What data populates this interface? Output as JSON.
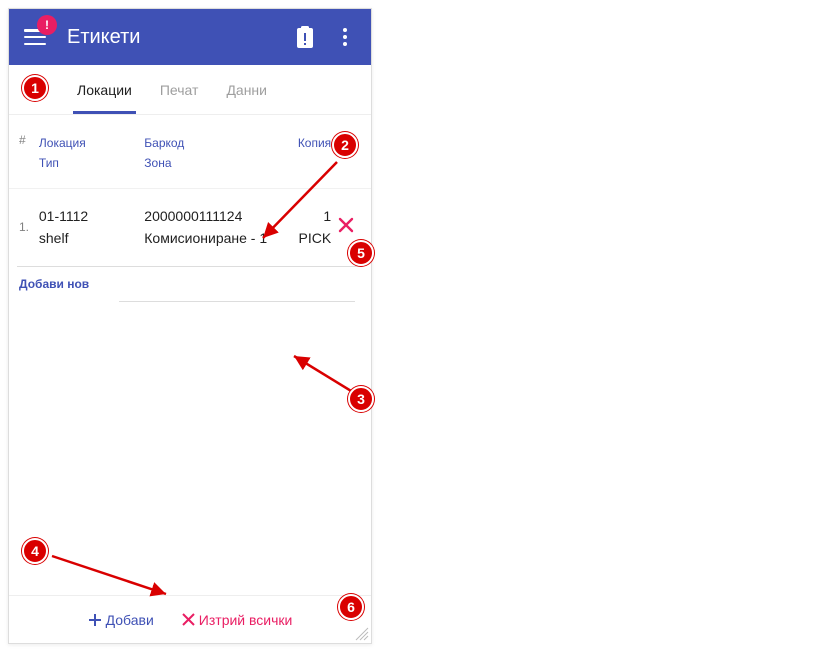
{
  "header": {
    "title": "Етикети",
    "alert_badge": "!"
  },
  "tabs": [
    {
      "label": "Локации",
      "active": true
    },
    {
      "label": "Печат",
      "active": false
    },
    {
      "label": "Данни",
      "active": false
    }
  ],
  "table": {
    "headers": {
      "index": "#",
      "col1a": "Локация",
      "col1b": "Тип",
      "col2a": "Баркод",
      "col2b": "Зона",
      "col3": "Копия"
    },
    "rows": [
      {
        "index": "1.",
        "location": "01-1112",
        "type": "shelf",
        "barcode": "2000000111124",
        "zone": "Комисиониране - 1",
        "copies": "1",
        "copies2": "PICK"
      }
    ]
  },
  "add_new_label": "Добави нов",
  "footer": {
    "add": "Добави",
    "delete_all": "Изтрий всички"
  },
  "callouts": {
    "c1": "1",
    "c2": "2",
    "c3": "3",
    "c4": "4",
    "c5": "5",
    "c6": "6"
  }
}
